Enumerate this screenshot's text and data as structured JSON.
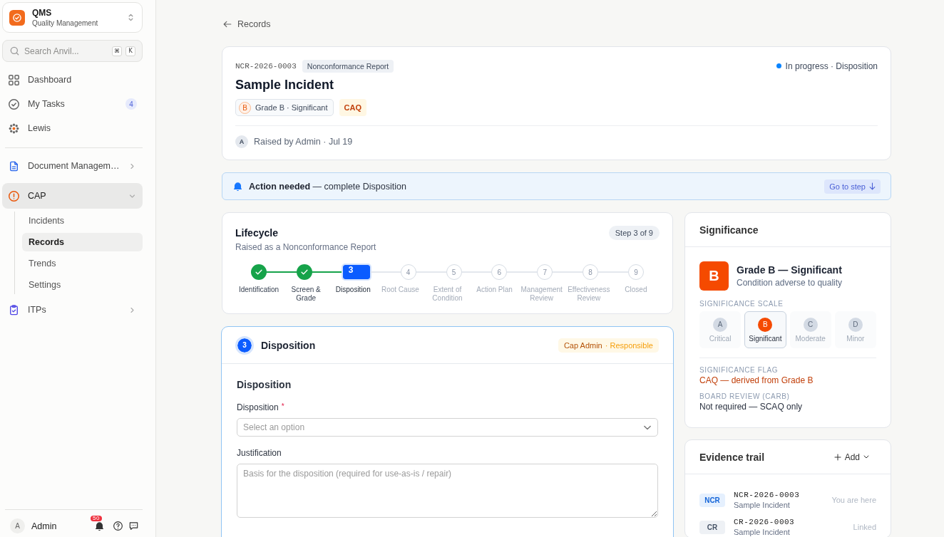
{
  "sidebar": {
    "workspace": {
      "name": "QMS",
      "subtitle": "Quality Management"
    },
    "search": {
      "placeholder": "Search Anvil...",
      "shortcut": [
        "⌘",
        "K"
      ]
    },
    "nav": [
      {
        "label": "Dashboard",
        "selected": false
      },
      {
        "label": "My Tasks",
        "badge": "4",
        "selected": false
      },
      {
        "label": "Lewis",
        "selected": false
      }
    ],
    "modules": [
      {
        "label": "Document Managem…",
        "expanded": false,
        "selected": false
      },
      {
        "label": "CAP",
        "expanded": true,
        "selected": true,
        "children": [
          {
            "label": "Incidents",
            "selected": false
          },
          {
            "label": "Records",
            "selected": true
          },
          {
            "label": "Trends",
            "selected": false
          },
          {
            "label": "Settings",
            "selected": false
          }
        ]
      },
      {
        "label": "ITPs",
        "expanded": false,
        "selected": false
      }
    ],
    "user": {
      "avatar": "A",
      "name": "Admin",
      "notifications": "50"
    }
  },
  "back_link": {
    "label": "Records"
  },
  "record": {
    "id": "NCR-2026-0003",
    "type": "Nonconformance Report",
    "status": "In progress · Disposition",
    "title": "Sample Incident",
    "grade": {
      "letter": "B",
      "label": "Grade B · Significant"
    },
    "flag": "CAQ",
    "raised": {
      "avatar": "A",
      "text": "Raised by Admin · Jul 19"
    }
  },
  "alert": {
    "text": "**Action needed** — complete Disposition",
    "button": "Go to step"
  },
  "lifecycle": {
    "title": "Lifecycle",
    "subtitle": "Raised as a Nonconformance Report",
    "step_badge": "Step 3 of 9",
    "steps": [
      {
        "label": "Identification",
        "done": true,
        "selected": false
      },
      {
        "label": "Screen & Grade",
        "done": true,
        "selected": false
      },
      {
        "number": "3",
        "label": "Disposition",
        "done": false,
        "selected": true
      },
      {
        "number": "4",
        "label": "Root Cause",
        "done": false,
        "selected": false
      },
      {
        "number": "5",
        "label": "Extent of Condition",
        "done": false,
        "selected": false
      },
      {
        "number": "6",
        "label": "Action Plan",
        "done": false,
        "selected": false
      },
      {
        "number": "7",
        "label": "Management Review",
        "done": false,
        "selected": false
      },
      {
        "number": "8",
        "label": "Effectiveness Review",
        "done": false,
        "selected": false
      },
      {
        "number": "9",
        "label": "Closed",
        "done": false,
        "selected": false
      }
    ]
  },
  "disposition": {
    "step": "3",
    "title": "Disposition",
    "owner": "Cap Admin",
    "role": "· Responsible",
    "section": "Disposition",
    "fields": [
      {
        "kind": "select",
        "label": "Disposition",
        "required_mark": "*",
        "placeholder": "Select an option"
      },
      {
        "kind": "textarea",
        "label": "Justification",
        "placeholder": "Basis for the disposition (required for use-as-is / repair)"
      }
    ]
  },
  "significance": {
    "title": "Significance",
    "grade_letter": "B",
    "grade_title": "Grade B — Significant",
    "grade_subtitle": "Condition adverse to quality",
    "scale_label": "SIGNIFICANCE SCALE",
    "scale": [
      {
        "letter": "A",
        "label": "Critical",
        "selected": false
      },
      {
        "letter": "B",
        "label": "Significant",
        "selected": true
      },
      {
        "letter": "C",
        "label": "Moderate",
        "selected": false
      },
      {
        "letter": "D",
        "label": "Minor",
        "selected": false
      }
    ],
    "details": [
      {
        "kind": "flag",
        "label": "SIGNIFICANCE FLAG",
        "value": "CAQ — derived from Grade B"
      },
      {
        "kind": "plain",
        "label": "BOARD REVIEW (CARB)",
        "value": "Not required — SCAQ only"
      }
    ]
  },
  "evidence": {
    "title": "Evidence trail",
    "add_button": "Add",
    "items": [
      {
        "type": "NCR",
        "id": "NCR-2026-0003",
        "title": "Sample Incident",
        "note": "You are here",
        "current": true
      },
      {
        "type": "CR",
        "id": "CR-2026-0003",
        "title": "Sample Incident",
        "note": "Linked",
        "current": false
      }
    ]
  }
}
